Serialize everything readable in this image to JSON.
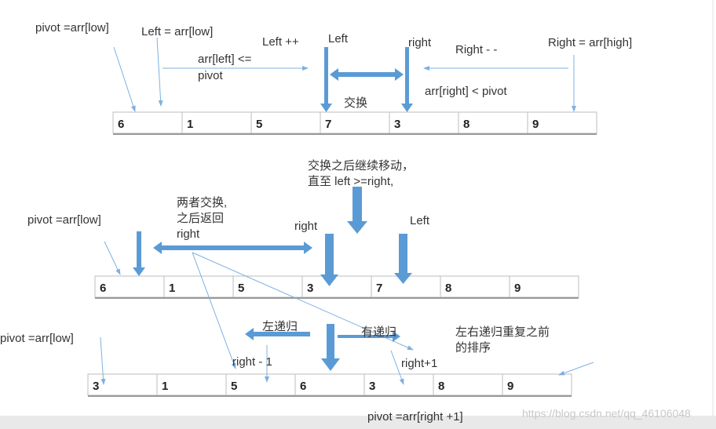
{
  "colors": {
    "arrow": "#5b9bd5",
    "thin": "#7fb0e0",
    "cell_border": "#bdbdbd"
  },
  "rows": [
    {
      "cells": [
        "6",
        "1",
        "5",
        "7",
        "3",
        "8",
        "9"
      ]
    },
    {
      "cells": [
        "6",
        "1",
        "5",
        "3",
        "7",
        "8",
        "9"
      ]
    },
    {
      "cells": [
        "3",
        "1",
        "5",
        "6",
        "3",
        "8",
        "9"
      ]
    }
  ],
  "labels": {
    "r1_pivot": "pivot =arr[low]",
    "r1_left_init": "Left = arr[low]",
    "r1_left_inc": "Left ++",
    "r1_left": "Left",
    "r1_right": "right",
    "r1_right_dec": "Right - -",
    "r1_right_init": "Right = arr[high]",
    "r1_cond_left_1": "arr[left] <=",
    "r1_cond_left_2": "pivot",
    "r1_cond_right": "arr[right] < pivot",
    "r1_swap": "交换",
    "mid_1": "交换之后继续移动，",
    "mid_2": "直至 left >=right,",
    "r2_pivot": "pivot =arr[low]",
    "r2_swap_1": "两者交换,",
    "r2_swap_2": "之后返回",
    "r2_swap_3": "right",
    "r2_right": "right",
    "r2_left": "Left",
    "r3_left_rec": "左递归",
    "r3_right_rec": "有递归",
    "r3_note_1": "左右递归重复之前",
    "r3_note_2": "的排序",
    "r3_pivot": "pivot =arr[low]",
    "r3_right_minus": "right - 1",
    "r3_right_plus": "right+1",
    "r3_pivot_right": "pivot =arr[right +1]"
  },
  "watermark": "https://blog.csdn.net/qq_46106048"
}
